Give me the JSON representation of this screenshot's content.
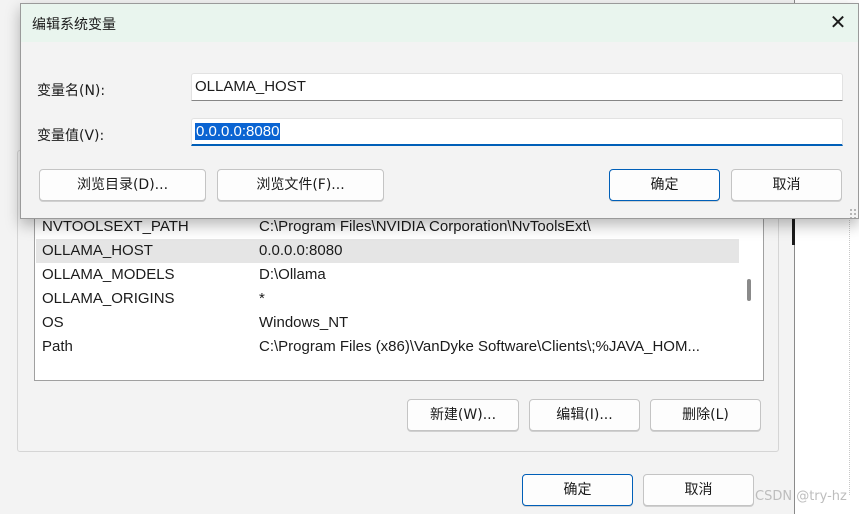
{
  "edit_dialog": {
    "title": "编辑系统变量",
    "close_glyph": "✕",
    "name_label": "变量名(N):",
    "name_value": "OLLAMA_HOST",
    "value_label": "变量值(V):",
    "value_value": "0.0.0.0:8080",
    "browse_dir_label": "浏览目录(D)...",
    "browse_file_label": "浏览文件(F)...",
    "ok_label": "确定",
    "cancel_label": "取消"
  },
  "system_variables": {
    "rows": [
      {
        "name": "NVTOOLSEXT_PATH",
        "value": "C:\\Program Files\\NVIDIA Corporation\\NvToolsExt\\"
      },
      {
        "name": "OLLAMA_HOST",
        "value": "0.0.0.0:8080"
      },
      {
        "name": "OLLAMA_MODELS",
        "value": "D:\\Ollama"
      },
      {
        "name": "OLLAMA_ORIGINS",
        "value": "*"
      },
      {
        "name": "OS",
        "value": "Windows_NT"
      },
      {
        "name": "Path",
        "value": "C:\\Program Files (x86)\\VanDyke Software\\Clients\\;%JAVA_HOM..."
      }
    ],
    "new_label": "新建(W)...",
    "edit_label": "编辑(I)...",
    "delete_label": "删除(L)"
  },
  "footer": {
    "ok_label": "确定",
    "cancel_label": "取消"
  },
  "watermark": "CSDN @try-hz"
}
